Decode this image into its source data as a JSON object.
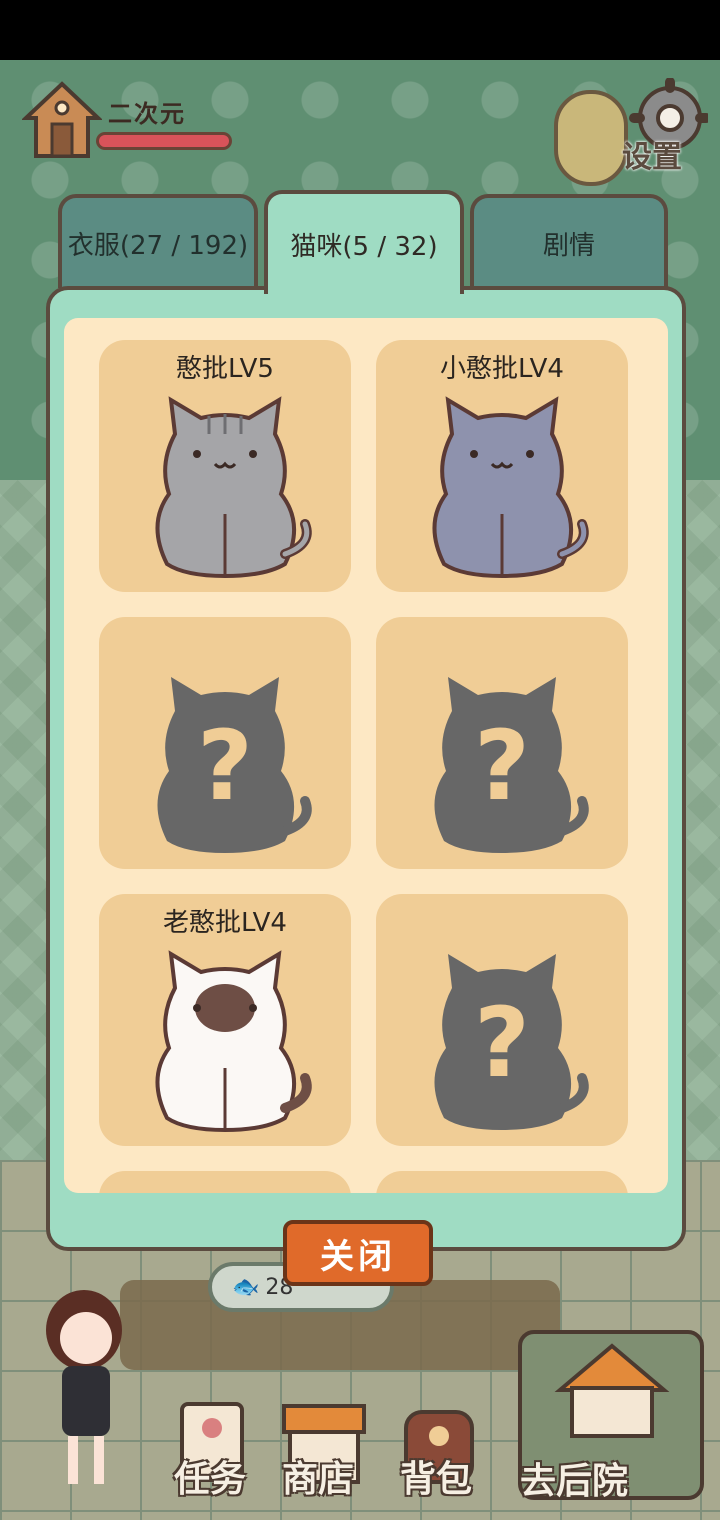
{
  "hud": {
    "player_name": "二次元",
    "hp_fraction": 1.0,
    "settings_label": "设置"
  },
  "tabs": [
    {
      "label": "衣服(27 / 192)",
      "active": false
    },
    {
      "label": "猫咪(5 / 32)",
      "active": true
    },
    {
      "label": "剧情",
      "active": false
    }
  ],
  "cats": [
    {
      "name": "憨批LV5",
      "unlocked": true,
      "icon": "gray-tabby-cat"
    },
    {
      "name": "小憨批LV4",
      "unlocked": true,
      "icon": "blue-gray-cat"
    },
    {
      "name": "",
      "unlocked": false,
      "icon": "unknown-cat-silhouette"
    },
    {
      "name": "",
      "unlocked": false,
      "icon": "unknown-cat-silhouette"
    },
    {
      "name": "老憨批LV4",
      "unlocked": true,
      "icon": "siamese-cat"
    },
    {
      "name": "",
      "unlocked": false,
      "icon": "unknown-cat-silhouette"
    }
  ],
  "close_label": "关闭",
  "fish_count": "28",
  "bottom_nav": {
    "tasks": "任务",
    "shop": "商店",
    "bag": "背包",
    "backyard": "去后院"
  },
  "colors": {
    "panel": "#9fdcc3",
    "inner": "#fde8c4",
    "card": "#f0cd96",
    "close_button": "#e06a2a",
    "hp": "#d9535a"
  }
}
